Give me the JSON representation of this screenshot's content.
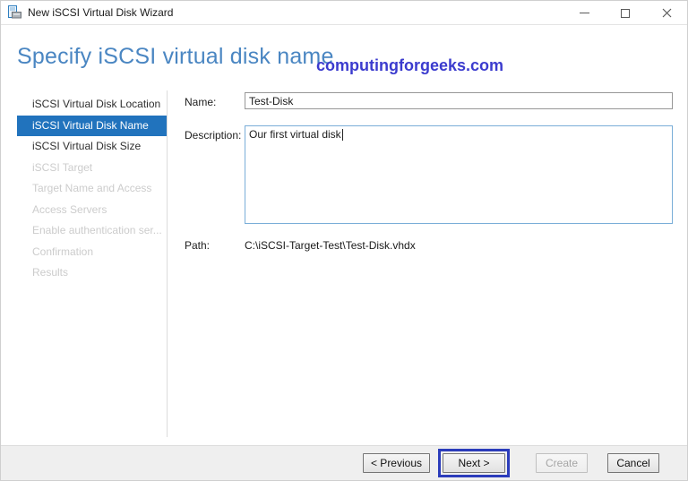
{
  "window": {
    "title": "New iSCSI Virtual Disk Wizard"
  },
  "icons": {
    "app": "wizard-app-icon",
    "minimize": "minimize-icon",
    "maximize": "maximize-icon",
    "close": "close-icon"
  },
  "page": {
    "heading": "Specify iSCSI virtual disk name",
    "watermark": "computingforgeeks.com"
  },
  "sidebar": {
    "items": [
      {
        "label": "iSCSI Virtual Disk Location",
        "state": "enabled"
      },
      {
        "label": "iSCSI Virtual Disk Name",
        "state": "selected"
      },
      {
        "label": "iSCSI Virtual Disk Size",
        "state": "enabled"
      },
      {
        "label": "iSCSI Target",
        "state": "disabled"
      },
      {
        "label": "Target Name and Access",
        "state": "disabled"
      },
      {
        "label": "Access Servers",
        "state": "disabled"
      },
      {
        "label": "Enable authentication ser...",
        "state": "disabled"
      },
      {
        "label": "Confirmation",
        "state": "disabled"
      },
      {
        "label": "Results",
        "state": "disabled"
      }
    ]
  },
  "form": {
    "name_label": "Name:",
    "name_value": "Test-Disk",
    "description_label": "Description:",
    "description_value": "Our first virtual disk",
    "path_label": "Path:",
    "path_value": "C:\\iSCSI-Target-Test\\Test-Disk.vhdx"
  },
  "footer": {
    "previous_label": "< Previous",
    "next_label": "Next >",
    "create_label": "Create",
    "cancel_label": "Cancel"
  },
  "colors": {
    "heading": "#4a86c2",
    "nav_selected_bg": "#2173bd",
    "watermark": "#3b3bce",
    "annotation": "#2b3cbb",
    "focus_border": "#7aaed8",
    "footer_bg": "#efefef"
  }
}
